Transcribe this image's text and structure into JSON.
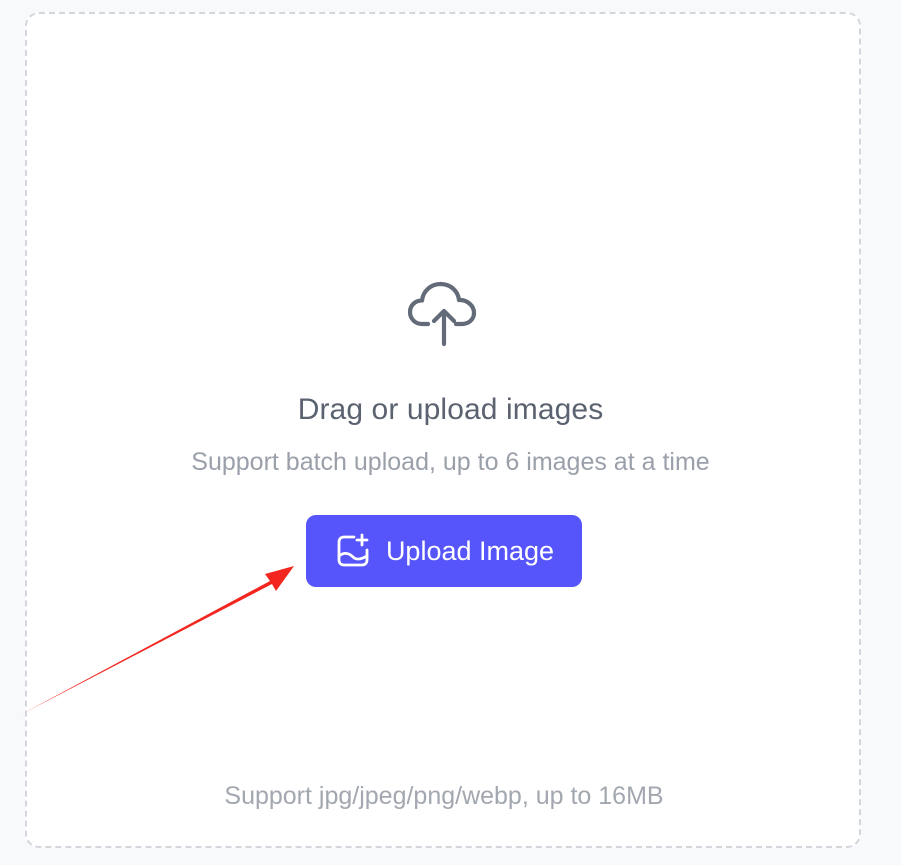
{
  "upload_panel": {
    "title": "Drag or upload images",
    "subtitle": "Support batch upload, up to 6 images at a time",
    "button_label": "Upload Image",
    "footer_note": "Support jpg/jpeg/png/webp, up to 16MB",
    "cloud_icon": "cloud-upload-icon",
    "button_icon": "image-add-icon"
  },
  "colors": {
    "accent": "#5654fb",
    "title_text": "#5b6270",
    "muted_text": "#9aa0aa",
    "border": "#d3d6dc",
    "annotation_arrow": "#f2261f"
  }
}
